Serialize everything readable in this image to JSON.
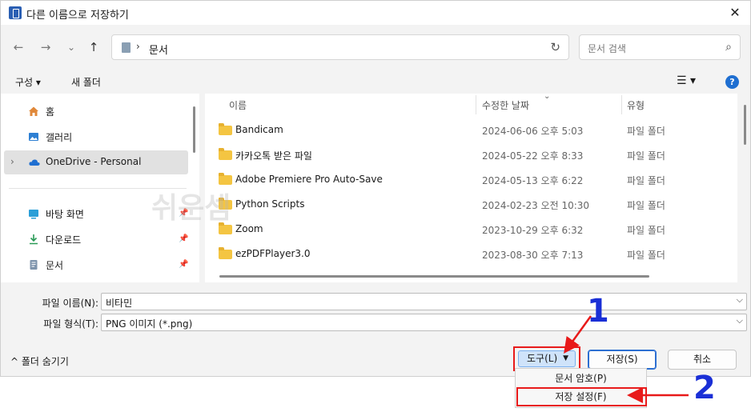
{
  "window": {
    "title": "다른 이름으로 저장하기",
    "close": "✕"
  },
  "nav": {
    "back": "←",
    "forward": "→",
    "recent": "⌄",
    "up": "↑",
    "path_sep": "›",
    "path": "문서",
    "refresh": "↻"
  },
  "search": {
    "placeholder": "문서 검색",
    "icon": "⌕"
  },
  "commands": {
    "organize": "구성 ▾",
    "new_folder": "새 폴더",
    "view": "☰ ▾",
    "help": "?"
  },
  "sidebar": {
    "items": [
      {
        "label": "홈",
        "icon": "home-icon"
      },
      {
        "label": "갤러리",
        "icon": "gallery-icon"
      },
      {
        "label": "OneDrive - Personal",
        "icon": "cloud-icon",
        "expander": "›"
      },
      {
        "label": "바탕 화면",
        "icon": "desktop-icon",
        "pin": "📌"
      },
      {
        "label": "다운로드",
        "icon": "download-icon",
        "pin": "📌"
      },
      {
        "label": "문서",
        "icon": "document-icon",
        "pin": "📌"
      }
    ]
  },
  "columns": {
    "name": "이름",
    "date": "수정한 날짜",
    "type": "유형",
    "sort": "⌄"
  },
  "files": [
    {
      "name": "Bandicam",
      "date": "2024-06-06 오후 5:03",
      "type": "파일 폴더"
    },
    {
      "name": "카카오톡 받은 파일",
      "date": "2024-05-22 오후 8:33",
      "type": "파일 폴더"
    },
    {
      "name": "Adobe Premiere Pro Auto-Save",
      "date": "2024-05-13 오후 6:22",
      "type": "파일 폴더"
    },
    {
      "name": "Python Scripts",
      "date": "2024-02-23 오전 10:30",
      "type": "파일 폴더"
    },
    {
      "name": "Zoom",
      "date": "2023-10-29 오후 6:32",
      "type": "파일 폴더"
    },
    {
      "name": "ezPDFPlayer3.0",
      "date": "2023-08-30 오후 7:13",
      "type": "파일 폴더"
    }
  ],
  "watermark": "쉬운셈",
  "form": {
    "filename_label": "파일 이름(N):",
    "filename_value": "비타민",
    "filetype_label": "파일 형식(T):",
    "filetype_value": "PNG 이미지 (*.png)",
    "dropdown": "⌵"
  },
  "footer": {
    "hide_folders": "^  폴더 숨기기",
    "tools": "도구(L)",
    "tools_arrow": "▼",
    "save": "저장(S)",
    "cancel": "취소"
  },
  "tools_menu": [
    "문서 암호(P)",
    "저장 설정(F)"
  ],
  "annotations": {
    "step1": "1",
    "step2": "2"
  },
  "colors": {
    "accent": "#1f6fd1",
    "highlight": "#e81a1a",
    "annotation": "#1a2fd6",
    "folder": "#f4c542"
  }
}
